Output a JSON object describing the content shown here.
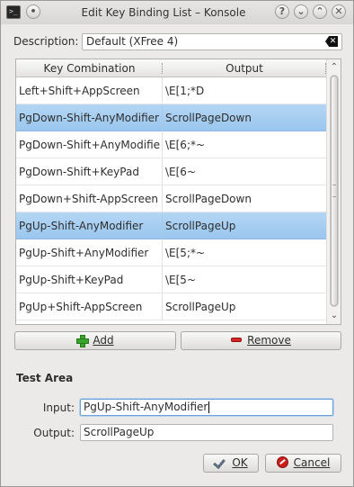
{
  "window": {
    "title": "Edit Key Binding List – Konsole",
    "buttons": {
      "help": "?",
      "minimize": "⌄",
      "maximize": "⌃",
      "close": "✕",
      "pin": "•"
    }
  },
  "description": {
    "label": "Description:",
    "value": "Default (XFree 4)"
  },
  "table": {
    "headers": {
      "key": "Key Combination",
      "output": "Output"
    },
    "rows": [
      {
        "key": "Left+Shift+AppScreen",
        "output": "\\E[1;*D",
        "selected": false
      },
      {
        "key": "PgDown-Shift-AnyModifier",
        "output": "ScrollPageDown",
        "selected": true
      },
      {
        "key": "PgDown-Shift+AnyModifier",
        "output": "\\E[6;*~",
        "selected": false
      },
      {
        "key": "PgDown-Shift+KeyPad",
        "output": "\\E[6~",
        "selected": false
      },
      {
        "key": "PgDown+Shift-AppScreen",
        "output": "ScrollPageDown",
        "selected": false
      },
      {
        "key": "PgUp-Shift-AnyModifier",
        "output": "ScrollPageUp",
        "selected": true
      },
      {
        "key": "PgUp-Shift+AnyModifier",
        "output": "\\E[5;*~",
        "selected": false
      },
      {
        "key": "PgUp-Shift+KeyPad",
        "output": "\\E[5~",
        "selected": false
      },
      {
        "key": "PgUp+Shift-AppScreen",
        "output": "ScrollPageUp",
        "selected": false
      }
    ]
  },
  "actions": {
    "add": "Add",
    "remove": "Remove"
  },
  "test_area": {
    "title": "Test Area",
    "input_label": "Input:",
    "input_value": "PgUp-Shift-AnyModifier",
    "output_label": "Output:",
    "output_value": "ScrollPageUp"
  },
  "dialog": {
    "ok": "OK",
    "cancel": "Cancel"
  },
  "colors": {
    "selection": "#9ac6ee",
    "add_icon": "#3aa52c",
    "remove_icon": "#d42828",
    "cancel_icon": "#c8211d"
  }
}
